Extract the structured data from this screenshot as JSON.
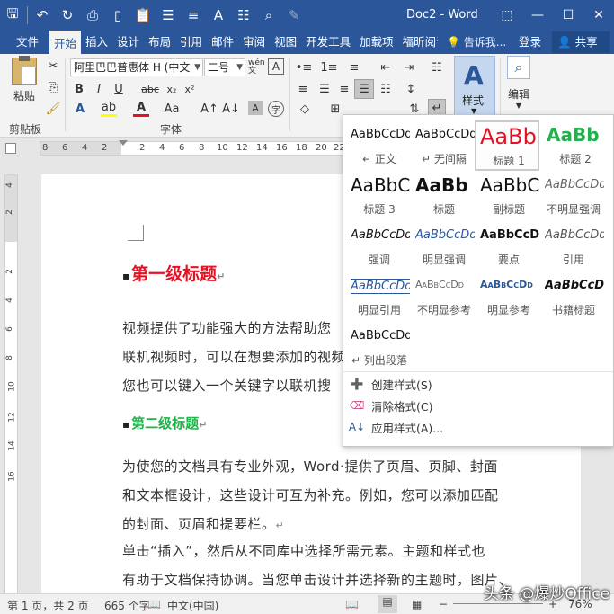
{
  "titlebar": {
    "doc_title": "Doc2 - Word",
    "qat_icons": [
      "save-icon",
      "undo-icon",
      "redo-icon",
      "print-preview-icon",
      "new-doc-icon",
      "paste-icon",
      "align-icon",
      "format-icon",
      "font-color-icon",
      "table-icon",
      "find-icon",
      "draw-icon"
    ]
  },
  "tabs": [
    "文件",
    "开始",
    "插入",
    "设计",
    "布局",
    "引用",
    "邮件",
    "审阅",
    "视图",
    "开发工具",
    "加载项",
    "福昕阅读"
  ],
  "tellme": "告诉我...",
  "login": "登录",
  "share": "共享",
  "ribbon": {
    "paste_label": "粘贴",
    "clipboard_label": "剪贴板",
    "font_group_label": "字体",
    "font_name": "阿里巴巴普惠体 H (中文",
    "font_size": "二号",
    "styles_label": "样式",
    "edit_label": "编辑",
    "wen": "wén 文"
  },
  "ruler_ticks": [
    "8",
    "6",
    "4",
    "2",
    "",
    "2",
    "4",
    "6",
    "8",
    "10",
    "12",
    "14",
    "16",
    "18",
    "20",
    "22"
  ],
  "vruler_ticks": [
    "4",
    "2",
    "",
    "2",
    "4",
    "6",
    "8",
    "10",
    "12",
    "14",
    "16"
  ],
  "document": {
    "heading1": "第一级标题",
    "para1": [
      "视频提供了功能强大的方法帮助您",
      "联机视频时，可以在想要添加的视频",
      "您也可以键入一个关键字以联机搜"
    ],
    "heading2": "第二级标题",
    "para2": [
      "为使您的文档具有专业外观，Word·提供了页眉、页脚、封面",
      "和文本框设计，这些设计可互为补充。例如，您可以添加匹配",
      "的封面、页眉和提要栏。"
    ],
    "para3": [
      "单击“插入”，然后从不同库中选择所需元素。主题和样式也",
      "有助于文档保持协调。当您单击设计并选择新的主题时，图片、"
    ]
  },
  "gallery": {
    "items": [
      {
        "sample": "AaBbCcDd",
        "name": "正文"
      },
      {
        "sample": "AaBbCcDd",
        "name": "无间隔"
      },
      {
        "sample": "AaBb",
        "name": "标题 1"
      },
      {
        "sample": "AaBb",
        "name": "标题 2"
      },
      {
        "sample": "AaBbC",
        "name": "标题 3"
      },
      {
        "sample": "AaBb",
        "name": "标题"
      },
      {
        "sample": "AaBbC",
        "name": "副标题"
      },
      {
        "sample": "AaBbCcDd",
        "name": "不明显强调"
      },
      {
        "sample": "AaBbCcDd",
        "name": "强调"
      },
      {
        "sample": "AaBbCcDd",
        "name": "明显强调"
      },
      {
        "sample": "AaBbCcD",
        "name": "要点"
      },
      {
        "sample": "AaBbCcDd",
        "name": "引用"
      },
      {
        "sample": "AaBbCcDd",
        "name": "明显引用"
      },
      {
        "sample": "AaBbCcDd",
        "name": "不明显参考"
      },
      {
        "sample": "AaBbCcDd",
        "name": "明显参考"
      },
      {
        "sample": "AaBbCcD",
        "name": "书籍标题"
      },
      {
        "sample": "AaBbCcDd",
        "name": "列出段落"
      }
    ],
    "commands": [
      "创建样式(S)",
      "清除格式(C)",
      "应用样式(A)..."
    ]
  },
  "statusbar": {
    "page": "第 1 页，共 2 页",
    "words": "665 个字",
    "language": "中文(中国)",
    "zoom": "76%"
  },
  "watermark": "头条 @爆炒Office",
  "colors": {
    "brand": "#2b579a",
    "heading1": "#e81123",
    "heading2": "#22b14c"
  }
}
